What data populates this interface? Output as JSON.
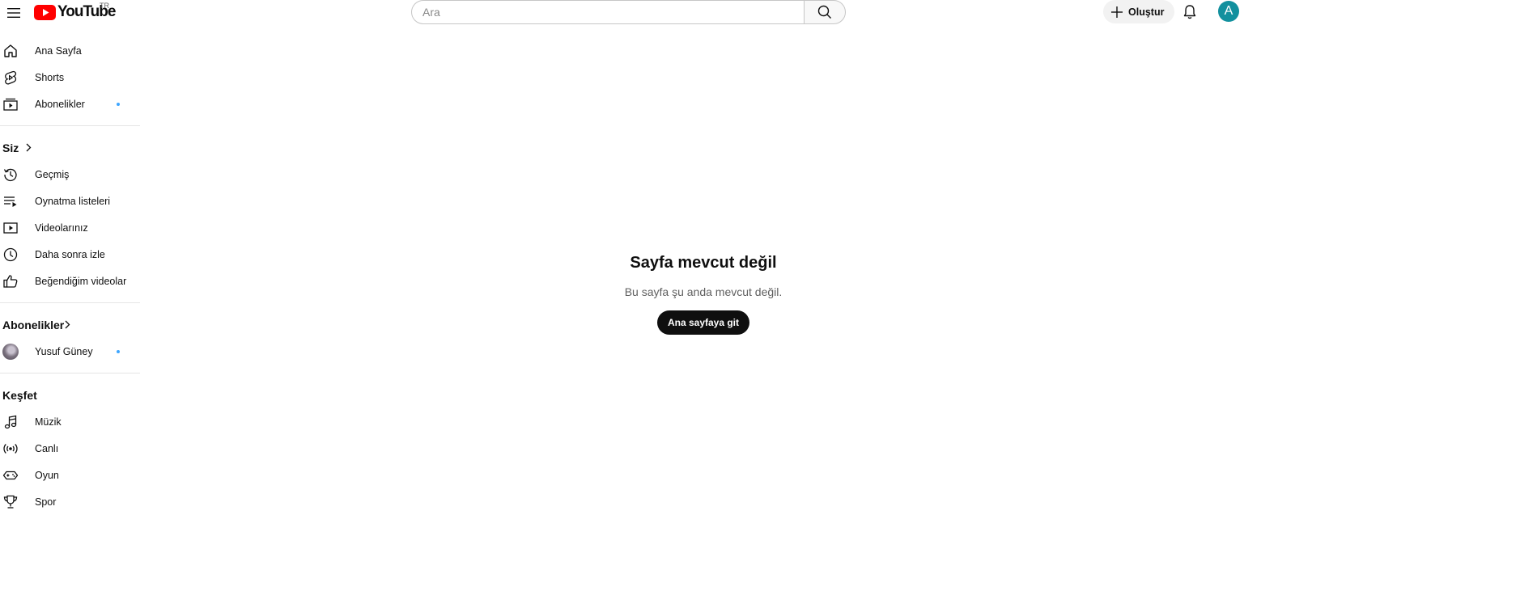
{
  "header": {
    "logo_text": "YouTube",
    "country_code": "TR",
    "search_placeholder": "Ara",
    "search_value": "",
    "create_label": "Oluştur",
    "avatar_letter": "A",
    "brand_red": "#ff0000",
    "avatar_color": "#12909e"
  },
  "sidebar": {
    "main_items": [
      {
        "label": "Ana Sayfa",
        "icon": "home-icon"
      },
      {
        "label": "Shorts",
        "icon": "shorts-icon"
      },
      {
        "label": "Abonelikler",
        "icon": "subscriptions-icon",
        "dot": true
      }
    ],
    "you_section": {
      "title": "Siz",
      "items": [
        {
          "label": "Geçmiş",
          "icon": "history-icon"
        },
        {
          "label": "Oynatma listeleri",
          "icon": "playlists-icon"
        },
        {
          "label": "Videolarınız",
          "icon": "your-videos-icon"
        },
        {
          "label": "Daha sonra izle",
          "icon": "watch-later-icon"
        },
        {
          "label": "Beğendiğim videolar",
          "icon": "liked-videos-icon"
        }
      ]
    },
    "subscriptions_section": {
      "title": "Abonelikler",
      "channels": [
        {
          "label": "Yusuf Güney",
          "icon": "channel-avatar",
          "dot": true
        }
      ]
    },
    "explore_section": {
      "title": "Keşfet",
      "items": [
        {
          "label": "Müzik",
          "icon": "music-icon"
        },
        {
          "label": "Canlı",
          "icon": "live-icon"
        },
        {
          "label": "Oyun",
          "icon": "gaming-icon"
        },
        {
          "label": "Spor",
          "icon": "trophy-icon"
        }
      ]
    },
    "new_dot_color": "#3ea6ff"
  },
  "main": {
    "error_title": "Sayfa mevcut değil",
    "error_message": "Bu sayfa şu anda mevcut değil.",
    "home_button_label": "Ana sayfaya git"
  }
}
